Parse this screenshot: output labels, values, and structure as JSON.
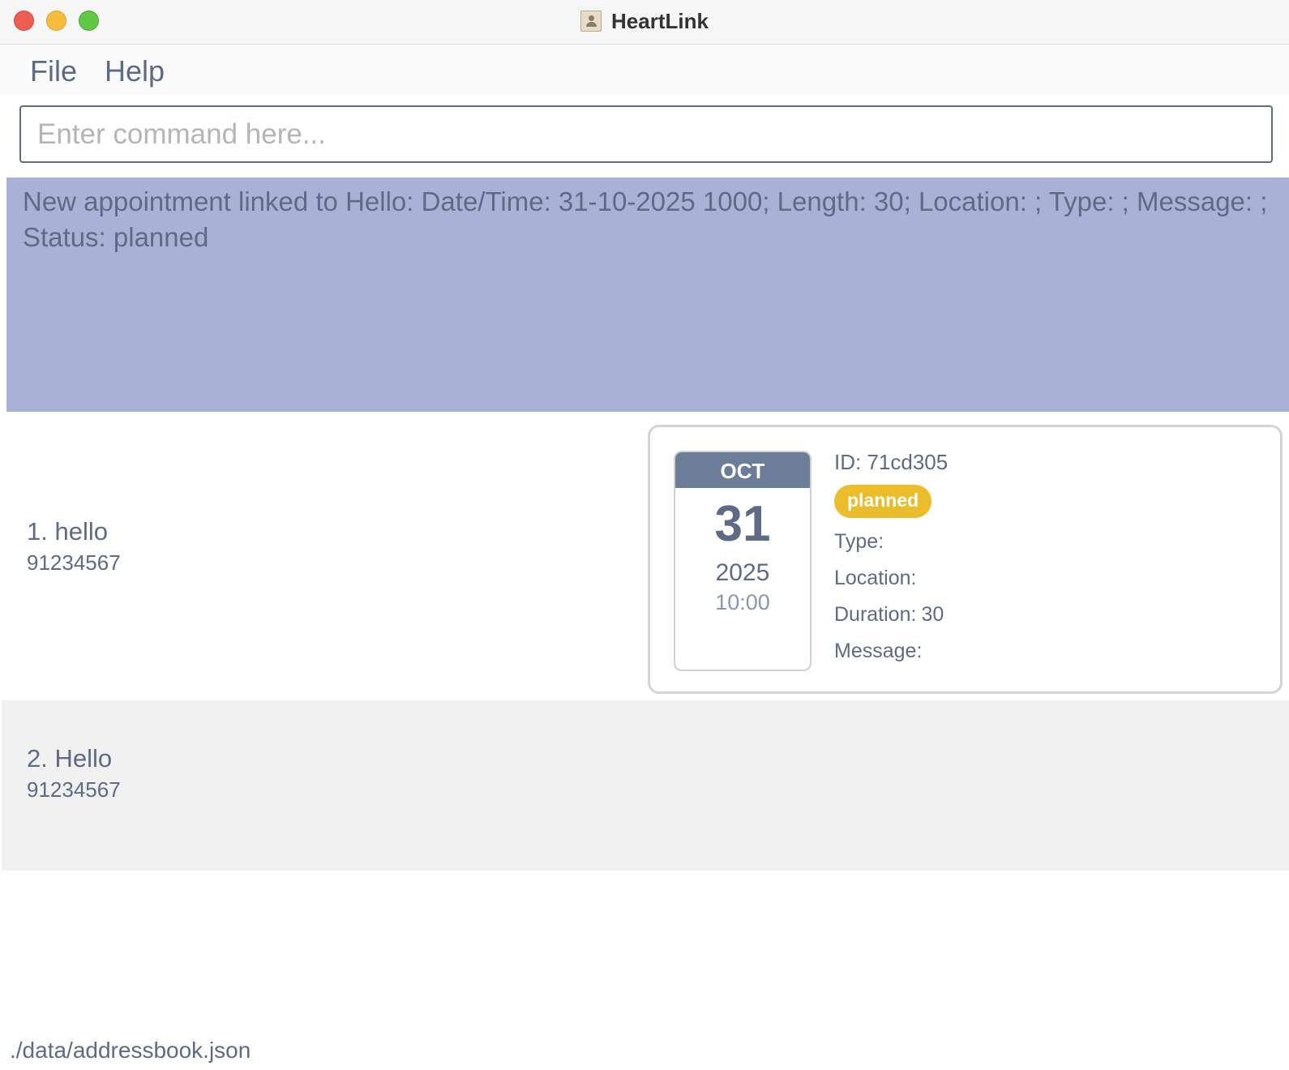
{
  "window": {
    "title": "HeartLink"
  },
  "menu": {
    "file": "File",
    "help": "Help"
  },
  "command": {
    "placeholder": "Enter command here...",
    "value": ""
  },
  "result": {
    "text": "New appointment linked to Hello: Date/Time: 31-10-2025 1000; Length: 30; Location: ; Type: ; Message: ; Status: planned"
  },
  "persons": [
    {
      "label": "1. hello",
      "phone": "91234567"
    },
    {
      "label": "2. Hello",
      "phone": "91234567"
    }
  ],
  "appointment": {
    "month": "OCT",
    "day": "31",
    "year": "2025",
    "time": "10:00",
    "id": "ID: 71cd305",
    "status": "planned",
    "status_color": "#ebbd2b",
    "type_label": "Type:",
    "type_value": "",
    "location_label": "Location:",
    "location_value": "",
    "duration_label": "Duration:",
    "duration_value": "30",
    "message_label": "Message:",
    "message_value": ""
  },
  "status_bar": {
    "path": "./data/addressbook.json"
  },
  "colors": {
    "result_bg": "#a9b1d7",
    "accent_text": "#5e6b85",
    "calendar_header": "#6c7d9a"
  }
}
